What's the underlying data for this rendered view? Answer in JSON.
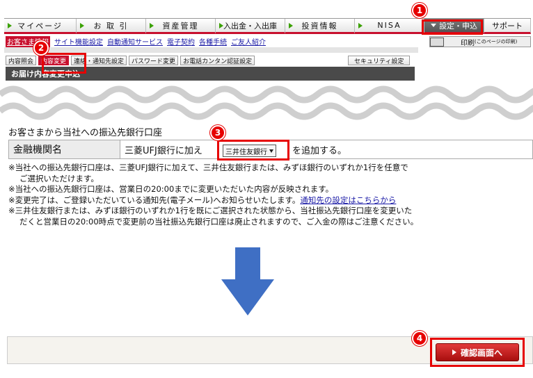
{
  "nav": {
    "items": [
      {
        "label": "マイページ"
      },
      {
        "label": "お 取 引"
      },
      {
        "label": "資産管理"
      },
      {
        "label": "入出金・入出庫"
      },
      {
        "label": "投資情報"
      },
      {
        "label": "NISA"
      },
      {
        "label": "設定・申込"
      },
      {
        "label": "サポート"
      }
    ]
  },
  "sublinks": [
    "お客さま情報",
    "サイト機能設定",
    "自動通知サービス",
    "電子契約",
    "各種手続",
    "ご友人紹介"
  ],
  "print": {
    "label": "印刷",
    "sub": "(このページの印刷)"
  },
  "tabs": [
    "内容照会",
    "内容変更",
    "連絡・通知先設定",
    "パスワード変更",
    "お電話カンタン認証設定"
  ],
  "security_tab": "セキュリティ設定",
  "title_bar": "お届け内容変更申込",
  "section_title": "お客さまから当社への振込先銀行口座",
  "bank": {
    "label": "金融機関名",
    "prefix": "三菱UFJ銀行に加え",
    "selected": "三井住友銀行",
    "suffix": "を追加する。"
  },
  "notes": {
    "n1a": "※当社への振込先銀行口座は、三菱UFJ銀行に加えて、三井住友銀行または、みずほ銀行のいずれか1行を任意で",
    "n1b": "ご選択いただけます。",
    "n2": "※当社への振込先銀行口座は、営業日の20:00までに変更いただいた内容が反映されます。",
    "n3": "※変更完了は、ご登録いただいている通知先(電子メール)へお知らせいたします。",
    "n3link": "通知先の設定はこちらから",
    "n4a": "※三井住友銀行または、みずほ銀行のいずれか1行を既にご選択された状態から、当社振込先銀行口座を変更いた",
    "n4b": "だくと営業日の20:00時点で変更前の当社振込先銀行口座は廃止されますので、ご入金の際はご注意ください。"
  },
  "confirm_button": "確認画面へ",
  "annotations": [
    "1",
    "2",
    "3",
    "4"
  ],
  "colors": {
    "accent": "#c8102e",
    "highlight": "#e60000",
    "arrow": "#3f6fc4",
    "nav_arrow": "#3aa100"
  }
}
